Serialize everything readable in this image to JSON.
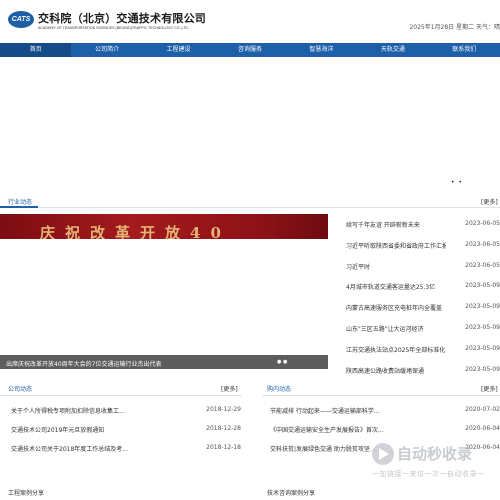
{
  "header": {
    "logo_mark": "CATS",
    "title": "交科院（北京）交通技术有限公司",
    "subtitle": "ACADEMY OF TRANSPORTATION SCIENCES (BEIJING)TRAFFIC TECHNOLOGY CO.,LTD.",
    "date": "2025年1月28日 星期二 天气：晴"
  },
  "nav": {
    "items": [
      "首页",
      "公司简介",
      "工程建设",
      "咨询服务",
      "智慧海洋",
      "天轨交通",
      "联系我们"
    ]
  },
  "carousel_dots": "• •",
  "industry": {
    "title": "行业动态",
    "more": "[更多]",
    "banner_text": "庆祝改革开放40",
    "banner_caption": "出席庆祝改革开放40周年大会的7位交通运输行业杰出代表",
    "banner_dots": "● ●",
    "items": [
      {
        "title": "续写千年友谊 开辟崭新未来",
        "date": "2023-06-05"
      },
      {
        "title": "习近平听取陕西省委和省政府工作汇报",
        "date": "2023-06-05"
      },
      {
        "title": "习近平时",
        "date": "2023-06-05"
      },
      {
        "title": "4月城市轨道交通客运量达25.3亿",
        "date": "2023-05-09"
      },
      {
        "title": "内蒙古高速服务区充电桩年内全覆盖",
        "date": "2023-05-09"
      },
      {
        "title": "山东\"三区五路\"让大运河经济",
        "date": "2023-05-09"
      },
      {
        "title": "江苏交通执法站点2025年全部标准化",
        "date": "2023-05-09"
      },
      {
        "title": "陕西高速公路收费站缓堵保通",
        "date": "2023-05-09"
      }
    ]
  },
  "company": {
    "title": "公司动态",
    "more": "[更多]",
    "items": [
      {
        "title": "关于个人所得税专项附加扣除信息收集工...",
        "date": "2018-12-29"
      },
      {
        "title": "交通技术公司2019年元旦放假通知",
        "date": "2018-12-28"
      },
      {
        "title": "交通技术公司关于2018年度工作总结及考...",
        "date": "2018-12-18"
      }
    ]
  },
  "shopping": {
    "title": "购内动态",
    "more": "[更多]",
    "items": [
      {
        "title": "节能减排 行动起来——交通运输部科学...",
        "date": "2020-07-02"
      },
      {
        "title": "《中国交通运输安全生产发展报告》首次...",
        "date": "2020-06-04"
      },
      {
        "title": "交科扶贫|发展绿色交通 助力脱贫攻坚...",
        "date": "2020-06-04"
      }
    ]
  },
  "bottom": {
    "left_title": "工程案例分享",
    "right_title": "技术咨询案例分享"
  },
  "watermark": {
    "title": "自动秒收录",
    "sub": "一加链接一来访一次一自动收录一"
  },
  "colors": {
    "brand": "#1d5fa8",
    "nav_active": "#154b88",
    "banner_red": "#a41a1d"
  }
}
